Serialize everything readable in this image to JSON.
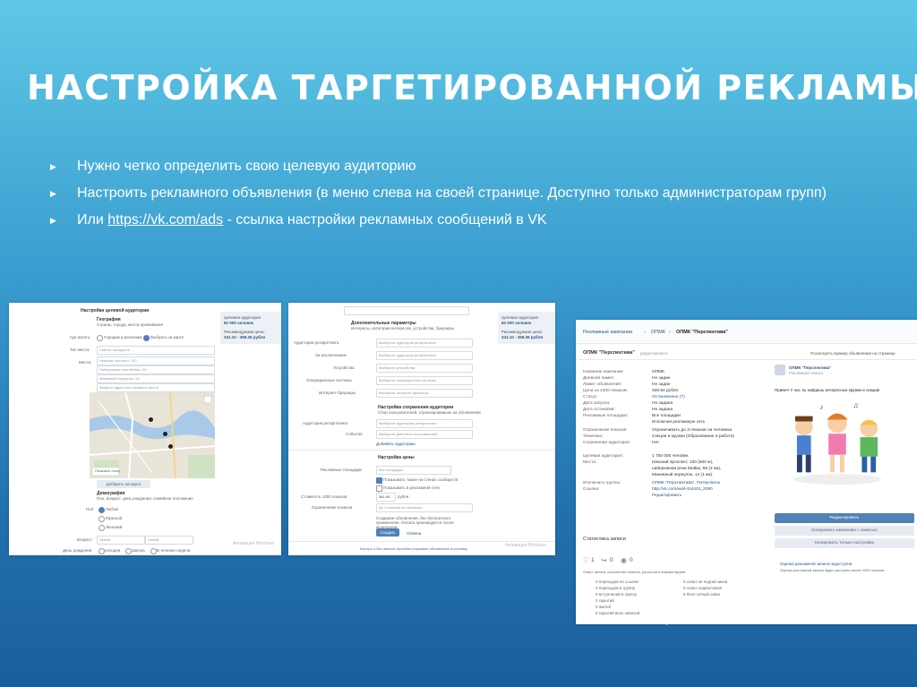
{
  "slide": {
    "title": "НАСТРОЙКА ТАРГЕТИРОВАННОЙ РЕКЛАМЫ",
    "bullet_marker": "▶",
    "bullets": [
      {
        "text": "Нужно четко определить  свою целевую аудиторию"
      },
      {
        "text": "Настроить рекламного объявления (в меню слева на своей странице. Доступно только администраторам групп)"
      },
      {
        "pre": "Или ",
        "link": "https://vk.com/ads",
        "post": " - ссылка настройки рекламных сообщений в VK"
      }
    ]
  },
  "shot1": {
    "heading": "Настройки целевой аудитории",
    "geo_label": "География",
    "geo_hint": "Страны, города, места проживания",
    "where_label": "Где искать:",
    "opt_city": "Городам и регионам",
    "opt_map": "Выбрать на карте",
    "type_label": "Тип места:",
    "type_value": "Сейчас находятся",
    "places_label": "Места:",
    "places": [
      "Невский проспект, 100",
      "Набережная реки Мойки, 59",
      "Маневный переулок, 14"
    ],
    "add_place": "Введите адрес или название места",
    "show_place": "Показать точку",
    "add_btn": "Добавить на карте",
    "demo_label": "Демография",
    "demo_hint": "Пол, возраст, день рождения, семейное положение",
    "sex_label": "Пол:",
    "sex_options": [
      "Любой",
      "Мужской",
      "Женский"
    ],
    "age_label": "Возраст:",
    "age_from": "Любой",
    "age_to": "Любой",
    "bday_label": "День рождения:",
    "bday_options": [
      "Сегодня",
      "Завтра",
      "В течение недели"
    ],
    "side_title": "Целевая аудитория",
    "side_value": "82 000 человек",
    "side_price_label": "Рекомендуемая цена:",
    "side_price": "341.10 - 368.36 рубля",
    "watermark": "Активация Windows"
  },
  "shot2": {
    "interests_head": "Дополнительные параметры",
    "interests_hint": "Интересы, категории интересов, устройства, браузеры",
    "fields": [
      {
        "label": "Аудитории ретаргетинга",
        "value": "Выберите аудитории ретаргетинга"
      },
      {
        "label": "За исключением",
        "value": "Выберите аудитории ретаргетинга"
      },
      {
        "label": "Устройства",
        "value": "Выберите устройства"
      },
      {
        "label": "Операционные системы",
        "value": "Выберите операционные системы"
      },
      {
        "label": "Интернет-браузеры",
        "value": "Выберите интернет-браузеры"
      }
    ],
    "audience_head": "Настройка сохранения аудитории",
    "audience_hint": "Сбор пользователей, отреагировавших на объявление",
    "save_label": "Аудитория ретаргетинга",
    "save_value": "Выберите аудиторию ретаргетинга",
    "events_label": "События",
    "events_value": "Выберите действия пользователей",
    "add_aud": "Добавить аудиторию",
    "price_head": "Настройка цены",
    "platform_label": "Рекламные площадки",
    "platform_value": "Все площадки",
    "cb1": "Показывать также на стенах сообществ",
    "cb2": "Показывать в рекламной сети",
    "cost_label": "Стоимость 1000 показов",
    "cost_value": "341.94",
    "currency": "рубля",
    "limit_label": "Ограничение показов",
    "limit_value": "До 3 показов на человека",
    "note": "Создание объявления, без бесплатного применения. Оплата производится после модерации.",
    "create_btn": "Создать",
    "cancel": "Отмена",
    "side_title": "Целевая аудитория",
    "side_value": "82 000 человек",
    "side_price_label": "Рекомендуемая цена:",
    "side_price": "341.10 - 368.36 рубля",
    "footer": "Быстро и без лишних проблем отправьте объявление в рекламу",
    "watermark": "Активация Windows"
  },
  "shot3": {
    "crumbs": [
      "Рекламные кампании",
      "ОПМК",
      "ОПМК \"Перспектива\""
    ],
    "title": "ОПМК \"Перспектива\"",
    "title_note": "редактировать",
    "preview_link": "Посмотреть пример объявления на странице",
    "rows": [
      {
        "k": "Название кампании:",
        "v": "ОПМК"
      },
      {
        "k": "Дневной лимит:",
        "v": "Не задан"
      },
      {
        "k": "Лимит объявления:",
        "v": "Не задан"
      },
      {
        "k": "Цена за 1000 показов:",
        "v": "338.84 рубля"
      },
      {
        "k": "Статус:",
        "v": "Остановлено (?)"
      },
      {
        "k": "Дата запуска:",
        "v": "Не задана"
      },
      {
        "k": "Дата остановки:",
        "v": "Не задана"
      },
      {
        "k": "Рекламные площадки:",
        "v": "Все площадки"
      },
      {
        "k": "",
        "v": "Исключая рекламную сеть"
      },
      {
        "k": "Ограничение показов:",
        "v": "Ограничивать до 3 показов на человека"
      },
      {
        "k": "Тематика:",
        "v": "Секции и кружки (Образование и работа)"
      },
      {
        "k": "Сохранение аудитории:",
        "v": "Нет"
      },
      {
        "k": "Целевая аудитория:",
        "v": "1 750 000 человек"
      },
      {
        "k": "Места:",
        "v": "Невский проспект, 100 (500 м),"
      },
      {
        "k": "",
        "v": "набережная реки Мойки, 59 (2 км),"
      },
      {
        "k": "",
        "v": "Маневный переулок, 14 (1 км)."
      },
      {
        "k": "Исключить группы:",
        "v": "ОПМК \"Перспектива\", Питер-Бель"
      },
      {
        "k": "Ссылка:",
        "v": "http://vk.com/wall-434402_2090"
      },
      {
        "k": "",
        "v": "Редактировать"
      }
    ],
    "ad_group": "ОПМК \"Перспектива\"",
    "ad_sub": "Рекламная запись",
    "ad_text": "Привет! У нас ты найдешь интересные кружки и секции!",
    "btn_edit": "Редактировать",
    "btn_copy": "Копировать кампанию с записью",
    "btn_settings": "Копировать только настройки",
    "rating_title": "Оценка рекламной записи недоступна",
    "rating_text": "Оценка рекламной записи будет доступна после 1000 показов.",
    "stats_title": "Статистика записи",
    "stat_likes": "1",
    "stat_shares": "0",
    "stat_views": "0",
    "stats_hint": "Охват записи, количество отметок, репостов и комментариев",
    "stats_left": [
      "0 переходов по ссылке",
      "0 переходов в группу",
      "0 вступлений в группу",
      "0 скрытий",
      "0 жалоб",
      "0 скрытий всех записей"
    ],
    "stats_right": [
      "0 охват не подписчиков",
      "0 охват подписчиков",
      "5 бесплатный охват"
    ]
  },
  "colors": {
    "accent": "#2a5885",
    "vk_button": "#5181b8",
    "bg_top": "#5fc8e6",
    "bg_bottom": "#1a5f9c"
  },
  "icons": [
    "triangle-bullet-icon",
    "map-pin-icon",
    "like-icon",
    "share-icon",
    "views-icon"
  ]
}
